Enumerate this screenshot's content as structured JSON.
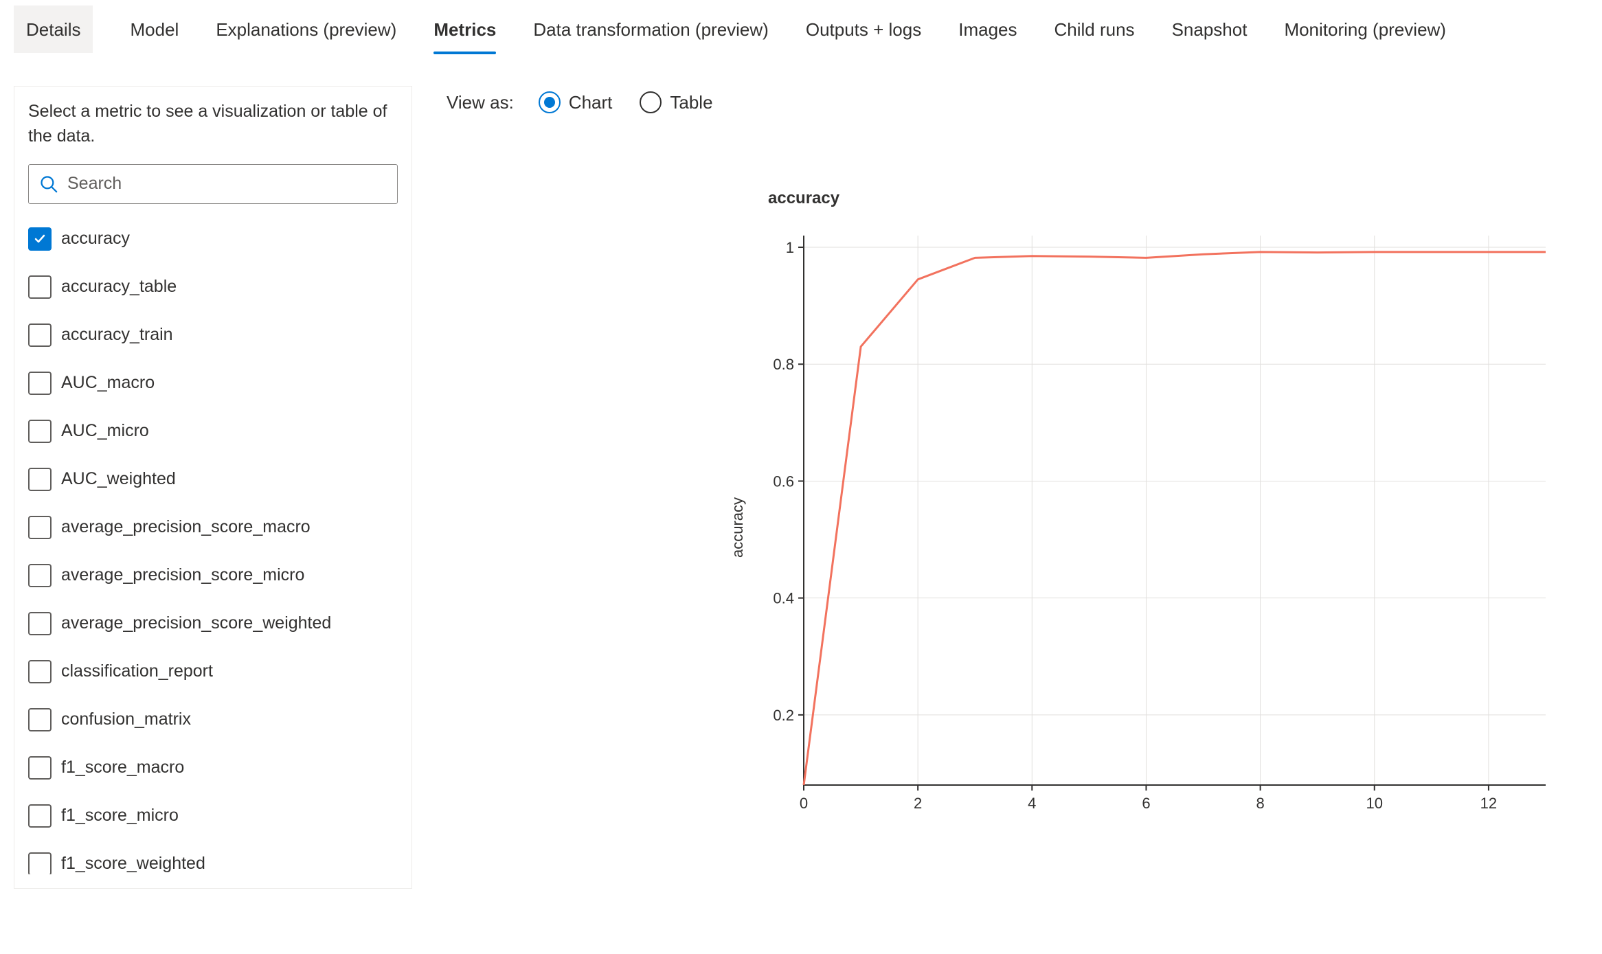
{
  "tabs": [
    {
      "label": "Details",
      "active": false,
      "style": "details"
    },
    {
      "label": "Model",
      "active": false
    },
    {
      "label": "Explanations (preview)",
      "active": false
    },
    {
      "label": "Metrics",
      "active": true
    },
    {
      "label": "Data transformation (preview)",
      "active": false
    },
    {
      "label": "Outputs + logs",
      "active": false
    },
    {
      "label": "Images",
      "active": false
    },
    {
      "label": "Child runs",
      "active": false
    },
    {
      "label": "Snapshot",
      "active": false
    },
    {
      "label": "Monitoring (preview)",
      "active": false
    }
  ],
  "sidebar": {
    "instruction": "Select a metric to see a visualization or table of the data.",
    "search_placeholder": "Search",
    "metrics": [
      {
        "label": "accuracy",
        "checked": true
      },
      {
        "label": "accuracy_table",
        "checked": false
      },
      {
        "label": "accuracy_train",
        "checked": false
      },
      {
        "label": "AUC_macro",
        "checked": false
      },
      {
        "label": "AUC_micro",
        "checked": false
      },
      {
        "label": "AUC_weighted",
        "checked": false
      },
      {
        "label": "average_precision_score_macro",
        "checked": false
      },
      {
        "label": "average_precision_score_micro",
        "checked": false
      },
      {
        "label": "average_precision_score_weighted",
        "checked": false
      },
      {
        "label": "classification_report",
        "checked": false
      },
      {
        "label": "confusion_matrix",
        "checked": false
      },
      {
        "label": "f1_score_macro",
        "checked": false
      },
      {
        "label": "f1_score_micro",
        "checked": false
      },
      {
        "label": "f1_score_weighted",
        "checked": false
      }
    ]
  },
  "viewas": {
    "label": "View as:",
    "options": [
      {
        "label": "Chart",
        "selected": true
      },
      {
        "label": "Table",
        "selected": false
      }
    ]
  },
  "chart_data": {
    "type": "line",
    "title": "accuracy",
    "ylabel": "accuracy",
    "xlabel": "",
    "xlim": [
      0,
      13
    ],
    "ylim": [
      0.08,
      1.02
    ],
    "x_ticks": [
      0,
      2,
      4,
      6,
      8,
      10,
      12
    ],
    "y_ticks": [
      0.2,
      0.4,
      0.6,
      0.8,
      1.0
    ],
    "series": [
      {
        "name": "accuracy",
        "color": "#f2725e",
        "x": [
          0,
          1,
          2,
          3,
          4,
          5,
          6,
          7,
          8,
          9,
          10,
          11,
          12,
          13
        ],
        "y": [
          0.08,
          0.83,
          0.945,
          0.982,
          0.985,
          0.984,
          0.982,
          0.988,
          0.992,
          0.991,
          0.992,
          0.992,
          0.992,
          0.992
        ]
      }
    ]
  }
}
